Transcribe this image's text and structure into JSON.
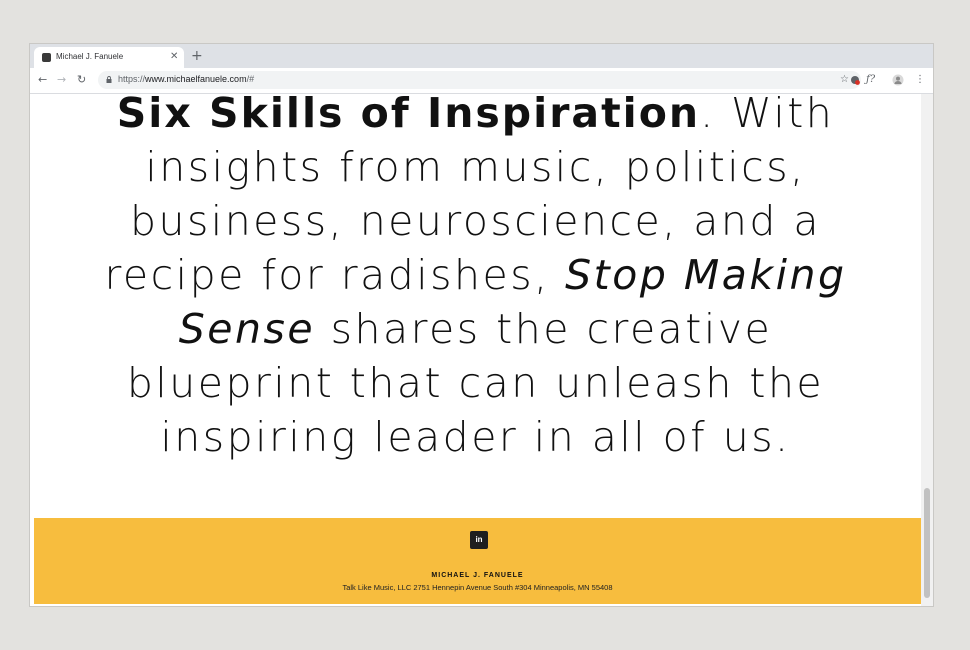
{
  "browser": {
    "tab_title": "Michael J. Fanuele",
    "tab_close": "✕",
    "new_tab": "+",
    "url_prefix": "https://",
    "url_host": "www.michaelfanuele.com",
    "url_suffix": "/#",
    "nav": {
      "back": "←",
      "forward": "→",
      "reload": "↻"
    },
    "toolbar_right": {
      "extension": "ƒ?",
      "star": "☆",
      "menu": "⋮"
    }
  },
  "hero": {
    "line1_bold": "Six Skills of Inspiration",
    "line1_rest": ". With",
    "line2": "insights from music, politics,",
    "line3": "business, neuroscience, and a",
    "line4_pre": "recipe for radishes, ",
    "line4_italic": "Stop Making",
    "line5_italic": "Sense",
    "line5_rest": " shares the creative",
    "line6": "blueprint that can unleash the",
    "line7": "inspiring leader in all of us."
  },
  "footer": {
    "social_icon": "linkedin-icon",
    "social_label": "in",
    "name": "MICHAEL J. FANUELE",
    "address": "Talk Like Music, LLC 2751 Hennepin Avenue South #304 Minneapolis, MN 55408",
    "background": "#f7bd3e"
  }
}
